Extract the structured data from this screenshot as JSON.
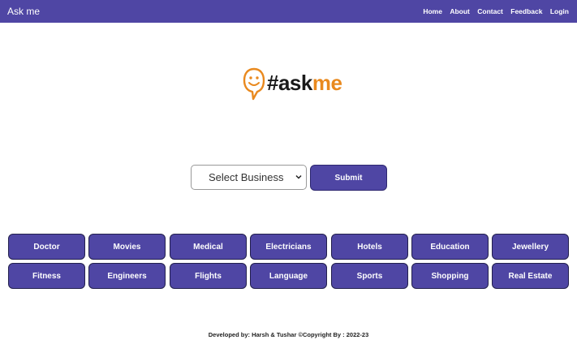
{
  "navbar": {
    "brand": "Ask me",
    "links": [
      "Home",
      "About",
      "Contact",
      "Feedback",
      "Login"
    ]
  },
  "logo": {
    "hash_text": "#ask",
    "accent_text": "me",
    "icon": "smiley-chat-icon",
    "accent_color": "#e9891e"
  },
  "search": {
    "select_value": "Select Business",
    "submit_label": "Submit"
  },
  "categories": [
    "Doctor",
    "Movies",
    "Medical",
    "Electricians",
    "Hotels",
    "Education",
    "Jewellery",
    "Fitness",
    "Engineers",
    "Flights",
    "Language",
    "Sports",
    "Shopping",
    "Real Estate"
  ],
  "footer": {
    "text": "Developed by: Harsh & Tushar ©Copyright By : 2022-23"
  },
  "colors": {
    "primary": "#4f46a4",
    "background": "#ffffff"
  }
}
